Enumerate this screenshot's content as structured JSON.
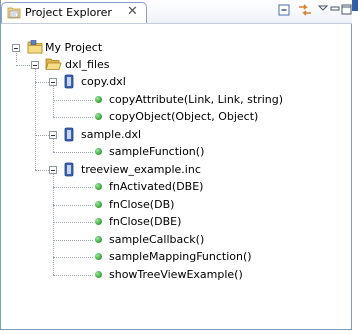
{
  "view": {
    "tab_title": "Project Explorer",
    "tab_close_glyph": "✕",
    "icons": [
      "project-explorer-icon",
      "close-icon",
      "collapse-all-icon",
      "link-with-editor-icon",
      "view-menu-icon",
      "minimize-icon",
      "maximize-icon"
    ]
  },
  "tree": {
    "project": {
      "label": "My Project",
      "expanded": true
    },
    "folder": {
      "label": "dxl_files",
      "expanded": true
    },
    "files": [
      {
        "label": "copy.dxl",
        "expanded": true,
        "functions": [
          "copyAttribute(Link, Link, string)",
          "copyObject(Object, Object)"
        ]
      },
      {
        "label": "sample.dxl",
        "expanded": true,
        "functions": [
          "sampleFunction()"
        ]
      },
      {
        "label": "treeview_example.inc",
        "expanded": true,
        "functions": [
          "fnActivated(DBE)",
          "fnClose(DB)",
          "fnClose(DBE)",
          "sampleCallback()",
          "sampleMappingFunction()",
          "showTreeViewExample()"
        ]
      }
    ]
  },
  "colors": {
    "accent": "#2e5aa0",
    "border": "#7f9db9",
    "function_dot": "#2ea12e",
    "folder": "#e8c15a",
    "file_icon": "#3a63b3"
  }
}
